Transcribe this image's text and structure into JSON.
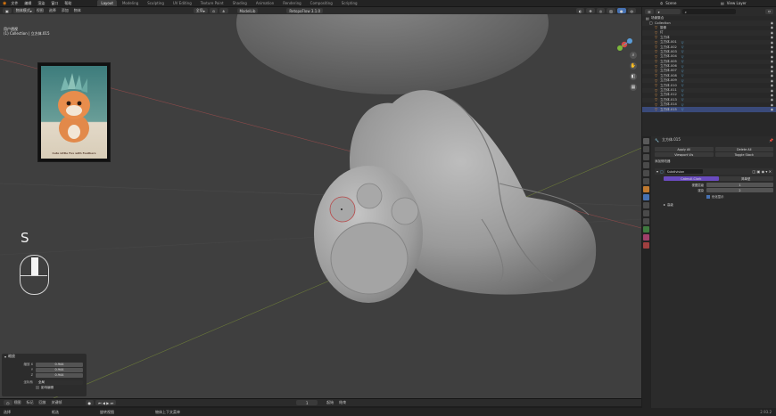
{
  "topbar": {
    "menus": [
      "文件",
      "编辑",
      "渲染",
      "窗口",
      "帮助"
    ],
    "workspaces": [
      "Layout",
      "Modeling",
      "Sculpting",
      "UV Editing",
      "Texture Paint",
      "Shading",
      "Animation",
      "Rendering",
      "Compositing",
      "Scripting"
    ],
    "active_workspace": "Layout",
    "scene_label": "Scene",
    "view_layer_label": "View Layer"
  },
  "vp_header": {
    "mode": "物体模式",
    "menus": [
      "视图",
      "选择",
      "添加",
      "物体"
    ],
    "orientation": "全局",
    "addon_label": "ModelLib",
    "addon_version": "RetopoFlow 3.1.0"
  },
  "viewport": {
    "info_line1": "用户透视",
    "info_line2": "(1) Collection | 立方体.015",
    "ref_caption": "Cute Little Fox with Feathers",
    "key_overlay": "S"
  },
  "op_panel": {
    "title": "缩放",
    "labels": [
      "缩放 X",
      "Y",
      "Z",
      "坐标系"
    ],
    "values": [
      "0.944",
      "0.944",
      "0.944",
      "全局"
    ],
    "checkbox_label": "影响编辑"
  },
  "timeline": {
    "items": [
      "视图",
      "标记",
      "回放",
      "关键帧"
    ],
    "frame": "1",
    "start_label": "起始",
    "end_label": "结束"
  },
  "statusbar": {
    "left1": "选择",
    "left2": "框选",
    "left3": "旋转视图",
    "left4": "物体上下文菜单",
    "version": "2.93.2"
  },
  "outliner": {
    "header_label": "场景集合",
    "search_placeholder": "",
    "collection": "Collection",
    "items": [
      {
        "name": "摄像",
        "mod": ""
      },
      {
        "name": "灯",
        "mod": ""
      },
      {
        "name": "立方体",
        "mod": ""
      },
      {
        "name": "立方体.001",
        "mod": "▽"
      },
      {
        "name": "立方体.002",
        "mod": "▽"
      },
      {
        "name": "立方体.003",
        "mod": "▽"
      },
      {
        "name": "立方体.004",
        "mod": "▽"
      },
      {
        "name": "立方体.005",
        "mod": "▽"
      },
      {
        "name": "立方体.006",
        "mod": "▽"
      },
      {
        "name": "立方体.007",
        "mod": "▽"
      },
      {
        "name": "立方体.008",
        "mod": "▽"
      },
      {
        "name": "立方体.009",
        "mod": "▽"
      },
      {
        "name": "立方体.010",
        "mod": "▽"
      },
      {
        "name": "立方体.011",
        "mod": "▽"
      },
      {
        "name": "立方体.012",
        "mod": "▽"
      },
      {
        "name": "立方体.013",
        "mod": "▽"
      },
      {
        "name": "立方体.014",
        "mod": "▽"
      },
      {
        "name": "立方体.015",
        "mod": "▽"
      }
    ],
    "selected_index": 17
  },
  "props": {
    "object_name": "立方体.015",
    "apply_all": "Apply All",
    "delete_all": "Delete All",
    "viewport_vis": "Viewport Vis",
    "toggle_stack": "Toggle Stack",
    "add_modifier": "添加修改器",
    "modifier_name": "Subdivision",
    "tab_catmull": "Catmull-Clark",
    "tab_simple": "简单型",
    "levels_viewport_label": "视图层级",
    "levels_viewport": "1",
    "render_label": "渲染",
    "render_value": "2",
    "optimal_display": "优化显示",
    "advanced": "高级"
  },
  "colors": {
    "accent": "#4772b3",
    "selected_row": "#3a4a7a",
    "active_tab": "#6a4bbf",
    "object_orange": "#e89b4b",
    "modifier_blue": "#5fb4e6"
  }
}
